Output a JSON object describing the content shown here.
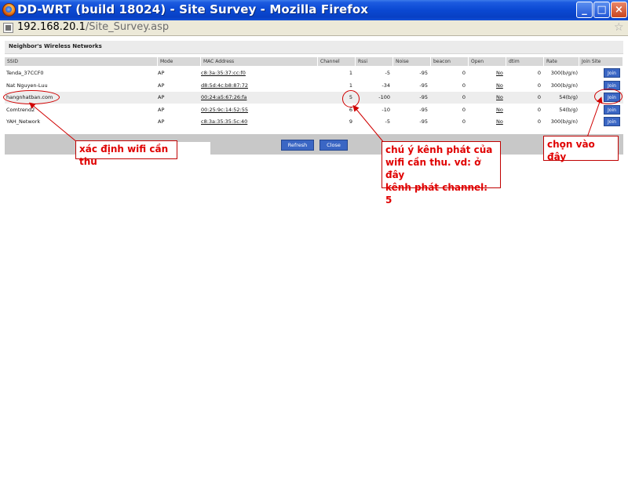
{
  "window": {
    "title": "DD-WRT (build 18024) - Site Survey - Mozilla Firefox",
    "controls": {
      "minimize": "_",
      "maximize": "□",
      "close": "×"
    }
  },
  "address": {
    "host": "192.168.20.1",
    "path": "/Site_Survey.asp"
  },
  "page": {
    "section_title": "Neighbor's Wireless Networks",
    "columns": [
      "SSID",
      "Mode",
      "MAC Address",
      "Channel",
      "Rssi",
      "Noise",
      "beacon",
      "Open",
      "dtim",
      "Rate",
      "Join Site"
    ],
    "rows": [
      {
        "ssid": "Tenda_37CCF0",
        "mode": "AP",
        "mac": "c8:3a:35:37:cc:f0",
        "channel": "1",
        "rssi": "-5",
        "noise": "-95",
        "beacon": "0",
        "open": "No",
        "dtim": "0",
        "rate": "300(b/g/n)",
        "join": "Join"
      },
      {
        "ssid": "Nat Nguyen-Luu",
        "mode": "AP",
        "mac": "d8:5d:4c:b8:87:72",
        "channel": "1",
        "rssi": "-34",
        "noise": "-95",
        "beacon": "0",
        "open": "No",
        "dtim": "0",
        "rate": "300(b/g/n)",
        "join": "Join"
      },
      {
        "ssid": "hangnhatban.com",
        "mode": "AP",
        "mac": "00:24:a5:67:26:fa",
        "channel": "5",
        "rssi": "-100",
        "noise": "-95",
        "beacon": "0",
        "open": "No",
        "dtim": "0",
        "rate": "54(b/g)",
        "join": "Join"
      },
      {
        "ssid": "Comtrend2",
        "mode": "AP",
        "mac": "00:25:9c:14:52:55",
        "channel": "6",
        "rssi": "-10",
        "noise": "-95",
        "beacon": "0",
        "open": "No",
        "dtim": "0",
        "rate": "54(b/g)",
        "join": "Join"
      },
      {
        "ssid": "YAH_Network",
        "mode": "AP",
        "mac": "c8:3a:35:35:5c:40",
        "channel": "9",
        "rssi": "-5",
        "noise": "-95",
        "beacon": "0",
        "open": "No",
        "dtim": "0",
        "rate": "300(b/g/n)",
        "join": "Join"
      }
    ],
    "refresh_label": "Refresh",
    "close_label": "Close"
  },
  "annotations": {
    "identify_wifi": "xác định wifi cần thu",
    "channel_note_1": "chú ý kênh phát của",
    "channel_note_2": "wifi cần thu. vd: ở đây",
    "channel_note_3": "kênh phát channel: 5",
    "click_here": "chọn vào đây"
  },
  "colors": {
    "annotation": "#e00000",
    "button": "#3a66c4",
    "titlebar": "#0a48d2"
  }
}
